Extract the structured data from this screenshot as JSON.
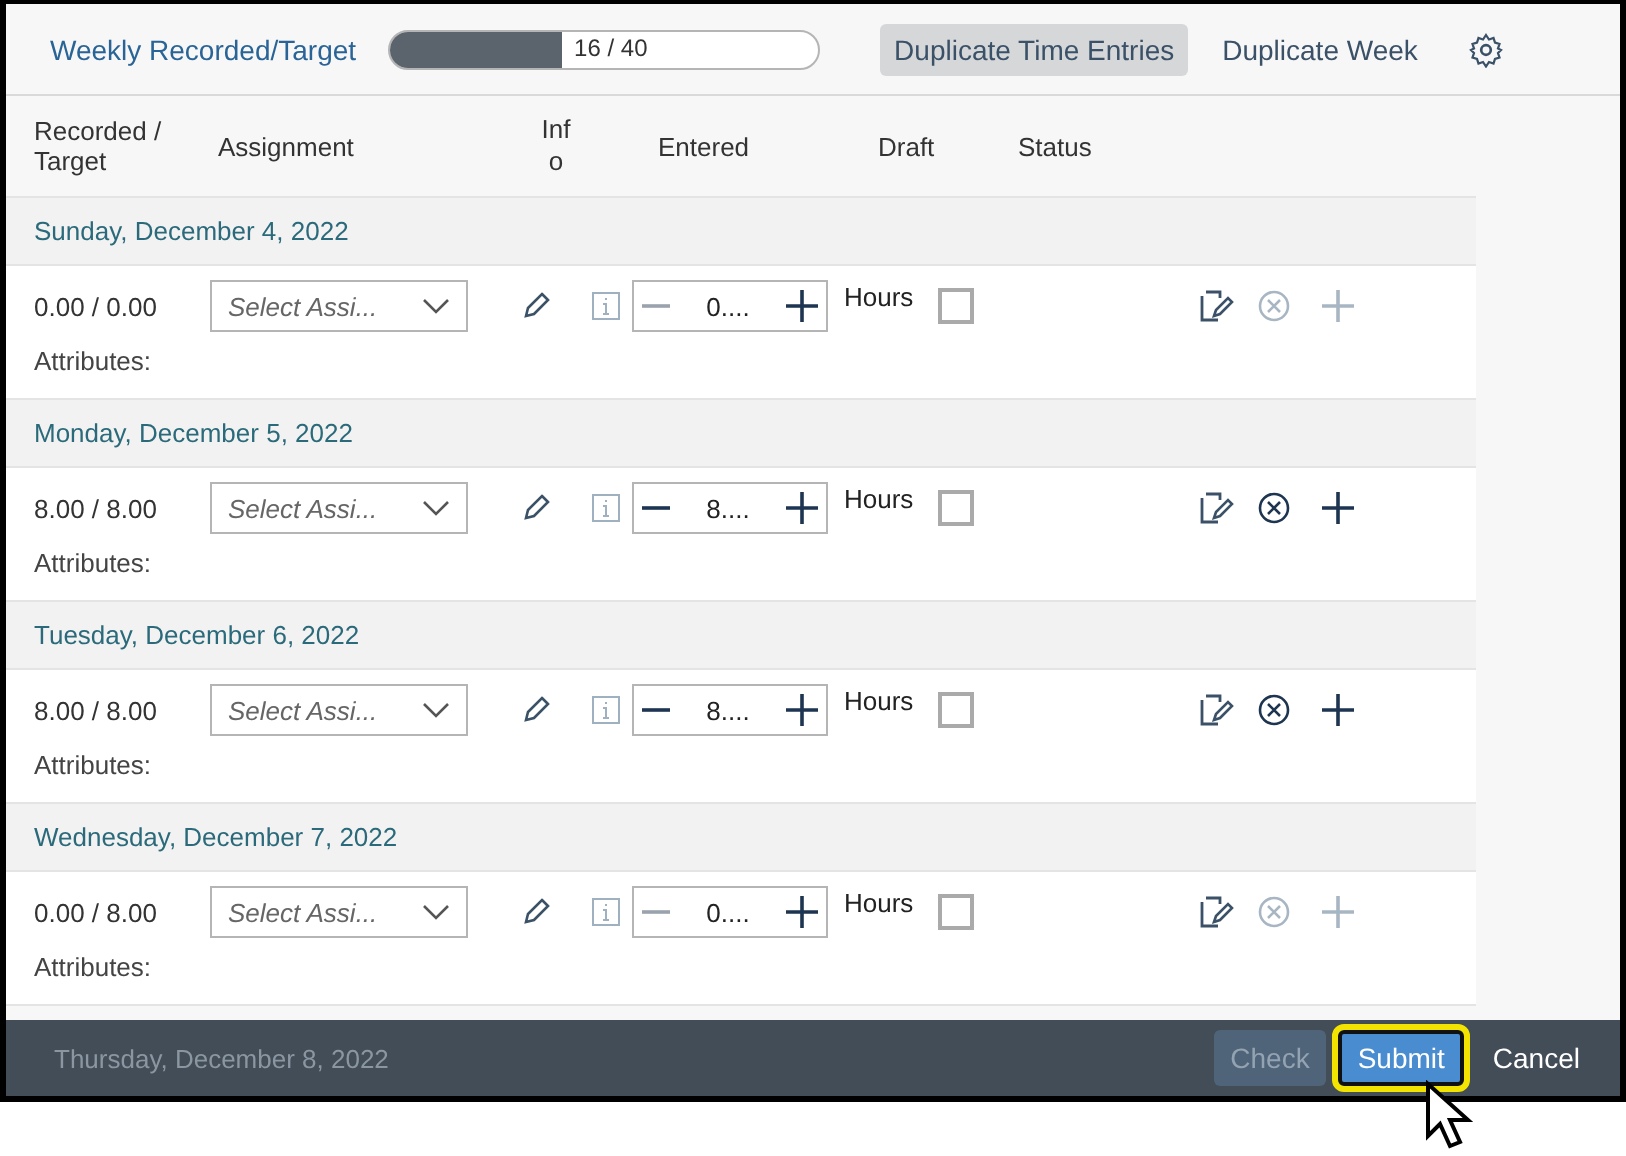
{
  "toolbar": {
    "title": "Weekly Recorded/Target",
    "progress": {
      "level": 0.4,
      "reading": "16 / 40"
    },
    "buttons": [
      {
        "label": "Duplicate Time Entries",
        "selected": true
      },
      {
        "label": "Duplicate Week",
        "selected": false
      }
    ]
  },
  "columns": [
    "Recorded / Target",
    "Assignment",
    "Inf o",
    "Entered",
    "Draft",
    "Status"
  ],
  "days": [
    {
      "date": "Sunday, December 4, 2022",
      "recorded": "0.00 / 0.00",
      "assignment_placeholder": "Select Assi...",
      "entered": "0....",
      "unit": "Hours",
      "draft": false,
      "decrease_enabled": false,
      "actions_enabled": false,
      "attributes": "Attributes:"
    },
    {
      "date": "Monday, December 5, 2022",
      "recorded": "8.00 / 8.00",
      "assignment_placeholder": "Select Assi...",
      "entered": "8....",
      "unit": "Hours",
      "draft": false,
      "decrease_enabled": true,
      "actions_enabled": true,
      "attributes": "Attributes:"
    },
    {
      "date": "Tuesday, December 6, 2022",
      "recorded": "8.00 / 8.00",
      "assignment_placeholder": "Select Assi...",
      "entered": "8....",
      "unit": "Hours",
      "draft": false,
      "decrease_enabled": true,
      "actions_enabled": true,
      "attributes": "Attributes:"
    },
    {
      "date": "Wednesday, December 7, 2022",
      "recorded": "0.00 / 8.00",
      "assignment_placeholder": "Select Assi...",
      "entered": "0....",
      "unit": "Hours",
      "draft": false,
      "decrease_enabled": false,
      "actions_enabled": false,
      "attributes": "Attributes:"
    }
  ],
  "next_day": "Thursday, December 8, 2022",
  "footer": {
    "buttons": [
      {
        "label": "Check",
        "disabled": true,
        "highlighted": false
      },
      {
        "label": "Submit",
        "disabled": false,
        "highlighted": true
      },
      {
        "label": "Cancel",
        "disabled": false,
        "highlighted": false
      }
    ]
  }
}
